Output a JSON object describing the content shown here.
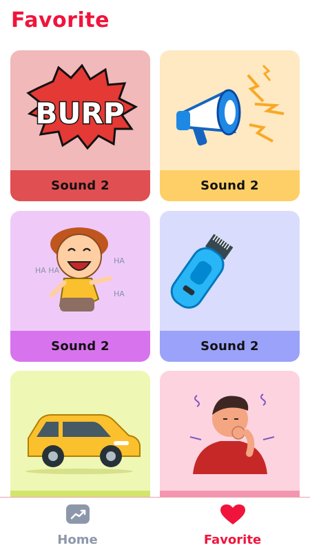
{
  "header": {
    "title": "Favorite"
  },
  "cards": [
    {
      "label": "Sound 2",
      "art": "burp-comic-icon",
      "bg": "#f1b9ba",
      "bar": "#e04f52",
      "art_text": "BURP"
    },
    {
      "label": "Sound 2",
      "art": "megaphone-icon",
      "bg": "#fee9c2",
      "bar": "#fecf66"
    },
    {
      "label": "Sound 2",
      "art": "laughing-boy-icon",
      "bg": "#efcaf8",
      "bar": "#d873ee"
    },
    {
      "label": "Sound 2",
      "art": "hair-clipper-icon",
      "bg": "#d9dcfc",
      "bar": "#9aa2f9"
    },
    {
      "label": "",
      "art": "yellow-car-icon",
      "bg": "#eef7b4",
      "bar": "#d3e56a"
    },
    {
      "label": "",
      "art": "coughing-man-icon",
      "bg": "#fdd3df",
      "bar": "#f596b1"
    }
  ],
  "bottom_nav": {
    "items": [
      {
        "label": "Home",
        "icon": "chart-icon",
        "active": false
      },
      {
        "label": "Favorite",
        "icon": "heart-icon",
        "active": true
      }
    ],
    "active_color": "#f0143c",
    "inactive_color": "#8c98aa"
  }
}
